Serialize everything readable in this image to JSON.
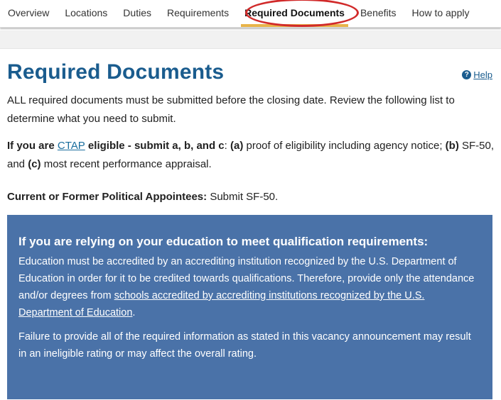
{
  "nav": {
    "items": [
      {
        "label": "Overview"
      },
      {
        "label": "Locations"
      },
      {
        "label": "Duties"
      },
      {
        "label": "Requirements"
      },
      {
        "label": "Required Documents",
        "active": true
      },
      {
        "label": "Benefits"
      },
      {
        "label": "How to apply"
      }
    ]
  },
  "help": {
    "label": "Help",
    "icon": "?"
  },
  "page": {
    "title": "Required Documents",
    "intro": "ALL required documents must be submitted before the closing date. Review the following list to determine what you need to submit.",
    "ctap": {
      "prefix": "If you are ",
      "link": "CTAP",
      "bold1": " eligible - submit a, b, and c",
      "colon": ": ",
      "a": "(a)",
      "a_text": " proof of eligibility including agency notice; ",
      "b": "(b)",
      "b_text": " SF-50, and ",
      "c": "(c)",
      "c_text": " most recent performance appraisal."
    },
    "political": {
      "label": "Current or Former Political Appointees:",
      "text": " Submit SF-50."
    }
  },
  "education_box": {
    "heading": "If you are relying on your education to meet qualification requirements:",
    "p1_text": "Education must be accredited by an accrediting institution recognized by the U.S. Department of Education in order for it to be credited towards qualifications. Therefore, provide only the attendance and/or degrees from ",
    "p1_link": "schools accredited by accrediting institutions recognized by the U.S. Department of Education",
    "p1_end": ".",
    "p2": "Failure to provide all of the required information as stated in this vacancy announcement may result in an ineligible rating or may affect the overall rating."
  },
  "colors": {
    "accent": "#1a5c8e",
    "box": "#4a72a8",
    "tab_underline": "#e8b44a",
    "annotation": "#d12a2a"
  }
}
